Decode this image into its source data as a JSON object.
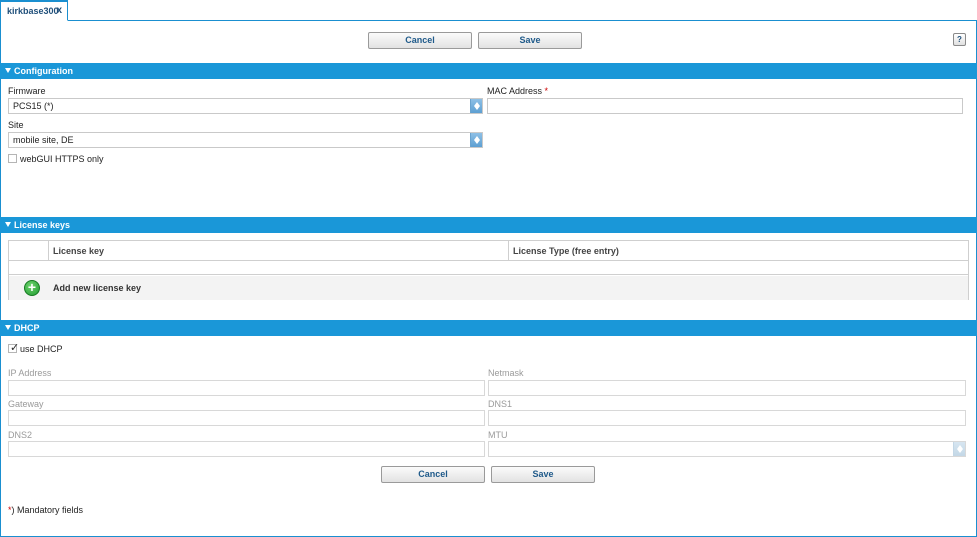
{
  "tab": {
    "title": "kirkbase300",
    "close": "x"
  },
  "toolbar": {
    "cancel_label": "Cancel",
    "save_label": "Save",
    "help_label": "?"
  },
  "configuration": {
    "header": "Configuration",
    "firmware_label": "Firmware",
    "firmware_value": "PCS15 (*)",
    "mac_label": "MAC Address",
    "mac_required": "*",
    "mac_value": "",
    "site_label": "Site",
    "site_value": "mobile site, DE",
    "https_label": "webGUI HTTPS only",
    "https_checked": false
  },
  "license_keys": {
    "header": "License keys",
    "columns": [
      "License key",
      "License Type (free entry)"
    ],
    "rows": [],
    "add_label": "Add new license key"
  },
  "dhcp": {
    "header": "DHCP",
    "use_dhcp_label": "use DHCP",
    "use_dhcp_checked": true,
    "ip_label": "IP Address",
    "netmask_label": "Netmask",
    "gateway_label": "Gateway",
    "dns1_label": "DNS1",
    "dns2_label": "DNS2",
    "mtu_label": "MTU"
  },
  "footer": {
    "cancel_label": "Cancel",
    "save_label": "Save",
    "mandatory_star": "*",
    "mandatory_text": ") Mandatory fields"
  },
  "colors": {
    "accent": "#1a97d8",
    "required": "#cc0000"
  },
  "icons": {
    "add": "plus-circle-icon",
    "section_toggle": "triangle-down-icon",
    "close": "close-icon",
    "help": "help-icon"
  }
}
